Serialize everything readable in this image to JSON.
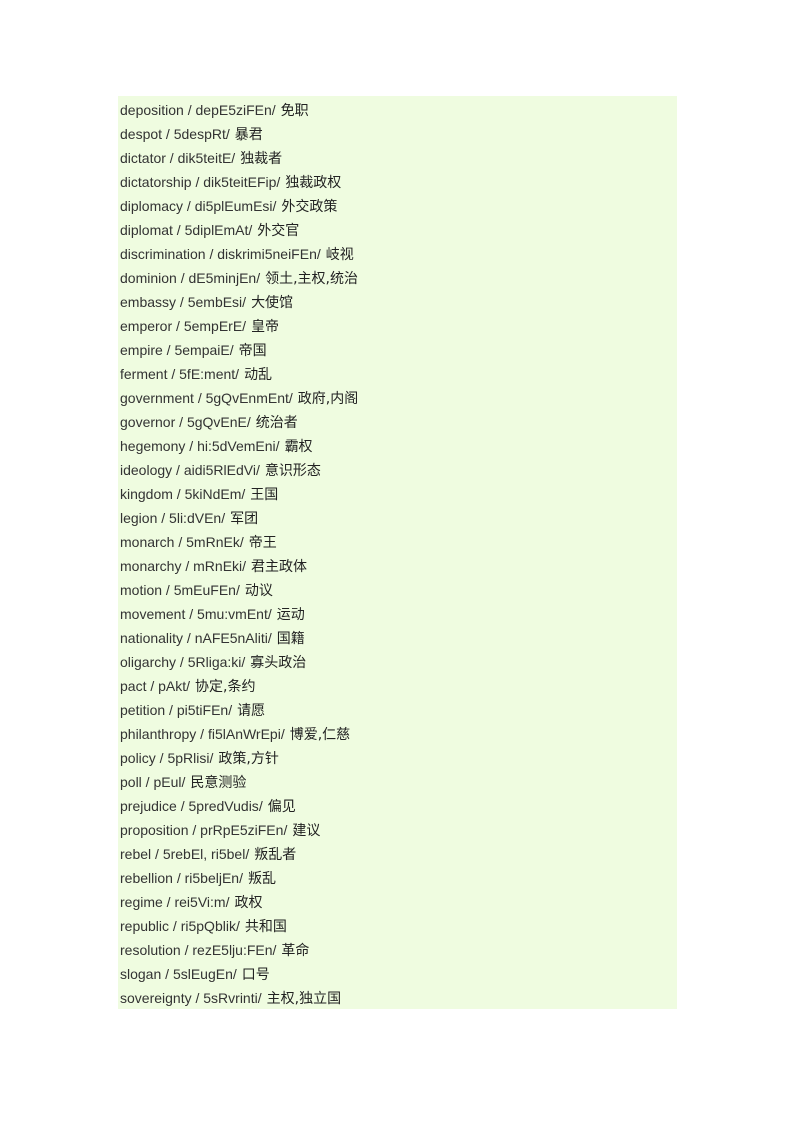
{
  "document": {
    "background_color": "#effce0",
    "text_color": "#333333",
    "entries": [
      {
        "word": "deposition",
        "phonetic": "depE5ziFEn",
        "meaning": "免职"
      },
      {
        "word": "despot",
        "phonetic": "5despRt",
        "meaning": "暴君"
      },
      {
        "word": "dictator",
        "phonetic": "dik5teitE",
        "meaning": "独裁者"
      },
      {
        "word": "dictatorship",
        "phonetic": "dik5teitEFip",
        "meaning": "独裁政权"
      },
      {
        "word": "diplomacy",
        "phonetic": "di5plEumEsi",
        "meaning": "外交政策"
      },
      {
        "word": "diplomat",
        "phonetic": "5diplEmAt",
        "meaning": "外交官"
      },
      {
        "word": "discrimination",
        "phonetic": "diskrimi5neiFEn",
        "meaning": "岐视"
      },
      {
        "word": "dominion",
        "phonetic": "dE5minjEn",
        "meaning": "领土,主权,统治"
      },
      {
        "word": "embassy",
        "phonetic": "5embEsi",
        "meaning": "大使馆"
      },
      {
        "word": "emperor",
        "phonetic": "5empErE",
        "meaning": "皇帝"
      },
      {
        "word": "empire",
        "phonetic": "5empaiE",
        "meaning": "帝国"
      },
      {
        "word": "ferment",
        "phonetic": "5fE:ment",
        "meaning": "动乱"
      },
      {
        "word": "government",
        "phonetic": "5gQvEnmEnt",
        "meaning": "政府,内阁"
      },
      {
        "word": "governor",
        "phonetic": "5gQvEnE",
        "meaning": "统治者"
      },
      {
        "word": "hegemony",
        "phonetic": "hi:5dVemEni",
        "meaning": "霸权"
      },
      {
        "word": "ideology",
        "phonetic": "aidi5RlEdVi",
        "meaning": "意识形态"
      },
      {
        "word": "kingdom",
        "phonetic": "5kiNdEm",
        "meaning": "王国"
      },
      {
        "word": "legion",
        "phonetic": "5li:dVEn",
        "meaning": "军团"
      },
      {
        "word": "monarch",
        "phonetic": "5mRnEk",
        "meaning": "帝王"
      },
      {
        "word": "monarchy",
        "phonetic": "mRnEki",
        "meaning": "君主政体"
      },
      {
        "word": "motion",
        "phonetic": "5mEuFEn",
        "meaning": "动议"
      },
      {
        "word": "movement",
        "phonetic": "5mu:vmEnt",
        "meaning": "运动"
      },
      {
        "word": "nationality",
        "phonetic": "nAFE5nAliti",
        "meaning": "国籍"
      },
      {
        "word": "oligarchy",
        "phonetic": "5Rliga:ki",
        "meaning": "寡头政治"
      },
      {
        "word": "pact",
        "phonetic": "pAkt",
        "meaning": "协定,条约"
      },
      {
        "word": "petition",
        "phonetic": "pi5tiFEn",
        "meaning": "请愿"
      },
      {
        "word": "philanthropy",
        "phonetic": "fi5lAnWrEpi",
        "meaning": "博爱,仁慈"
      },
      {
        "word": "policy",
        "phonetic": "5pRlisi",
        "meaning": "政策,方针"
      },
      {
        "word": "poll",
        "phonetic": "pEul",
        "meaning": "民意测验"
      },
      {
        "word": "prejudice",
        "phonetic": "5predVudis",
        "meaning": "偏见"
      },
      {
        "word": "proposition",
        "phonetic": "prRpE5ziFEn",
        "meaning": "建议"
      },
      {
        "word": "rebel",
        "phonetic": "5rebEl, ri5bel",
        "meaning": "叛乱者"
      },
      {
        "word": "rebellion",
        "phonetic": "ri5beljEn",
        "meaning": "叛乱"
      },
      {
        "word": "regime",
        "phonetic": "rei5Vi:m",
        "meaning": "政权"
      },
      {
        "word": "republic",
        "phonetic": "ri5pQblik",
        "meaning": "共和国"
      },
      {
        "word": "resolution",
        "phonetic": "rezE5lju:FEn",
        "meaning": "革命"
      },
      {
        "word": "slogan",
        "phonetic": "5slEugEn",
        "meaning": "口号"
      },
      {
        "word": "sovereignty",
        "phonetic": "5sRvrinti",
        "meaning": "主权,独立国"
      }
    ]
  }
}
